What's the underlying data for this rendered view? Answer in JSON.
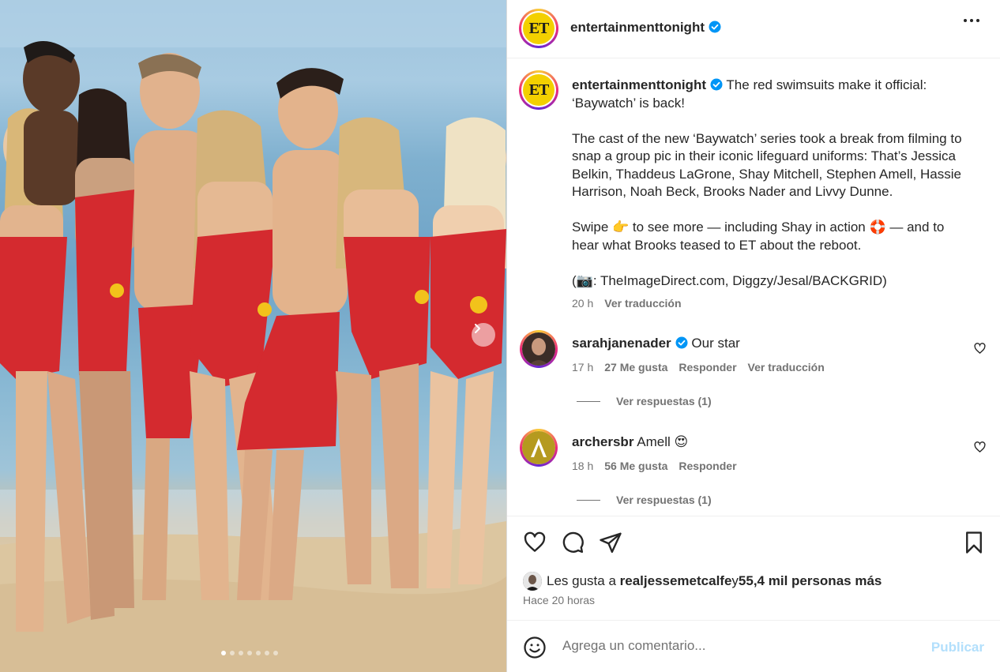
{
  "post": {
    "author": "entertainmenttonight",
    "author_logo": "ET",
    "verified": true,
    "photo_alt": "Baywatch cast group photo on beach",
    "carousel_count": 7,
    "carousel_active": 0
  },
  "caption": {
    "author": "entertainmenttonight",
    "line1": "The red swimsuits make it official: ‘Baywatch’ is back!",
    "para2": "The cast of the new ‘Baywatch’ series took a break from filming to snap a group pic in their iconic lifeguard uniforms: That’s Jessica Belkin, Thaddeus LaGrone, Shay Mitchell, Stephen Amell, Hassie Harrison, Noah Beck, Brooks Nader and Livvy Dunne.",
    "para3_a": "Swipe ",
    "para3_emoji1": "👉",
    "para3_b": " to see more — including Shay in action ",
    "para3_emoji2": "🛟",
    "para3_c": " — and to hear what Brooks teased to ET about the reboot.",
    "para4_a": "(",
    "para4_emoji": "📷",
    "para4_b": ": TheImageDirect.com, Diggzy/Jesal/BACKGRID)",
    "time": "20 h",
    "translate": "Ver traducción"
  },
  "comments": [
    {
      "user": "sarahjanenader",
      "verified": true,
      "text": "Our star",
      "time": "17 h",
      "likes": "27 Me gusta",
      "reply": "Responder",
      "translate": "Ver traducción",
      "replies": "Ver respuestas (1)"
    },
    {
      "user": "archersbr",
      "verified": false,
      "text": "Amell ",
      "emoji": "😍",
      "time": "18 h",
      "likes": "56 Me gusta",
      "reply": "Responder",
      "replies": "Ver respuestas (1)"
    }
  ],
  "likes": {
    "prefix": "Les gusta a ",
    "user": "realjessemetcalfe",
    "middle": " y ",
    "others": "55,4 mil personas más",
    "time_ago": "Hace 20 horas"
  },
  "composer": {
    "placeholder": "Agrega un comentario...",
    "publish": "Publicar"
  },
  "icons": {
    "like": "heart-icon",
    "comment": "comment-icon",
    "share": "share-icon",
    "save": "bookmark-icon",
    "emoji": "emoji-icon",
    "more": "more-icon",
    "next": "chevron-right-icon"
  },
  "colors": {
    "verified": "#0095f6",
    "publish_disabled": "#b2dffc",
    "et_logo": "#f3d000",
    "swimsuit": "#d42a2f"
  }
}
